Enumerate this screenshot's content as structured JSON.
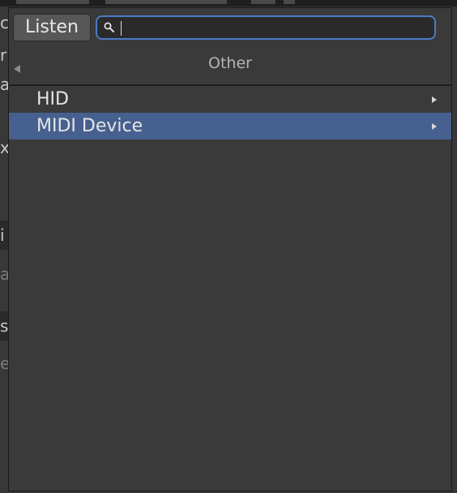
{
  "background_peek": [
    {
      "text": "c",
      "dim": false
    },
    {
      "text": "r",
      "dim": false
    },
    {
      "text": "a",
      "dim": false
    },
    {
      "text": "x",
      "dim": false
    },
    {
      "text": "i",
      "dim": false
    },
    {
      "text": "a",
      "dim": true
    },
    {
      "text": "sc",
      "dim": false
    },
    {
      "text": "e",
      "dim": true
    }
  ],
  "toolbar": {
    "listen_label": "Listen",
    "search_value": "",
    "search_icon": "magnifier-icon"
  },
  "header": {
    "title": "Other",
    "back_icon": "back-arrow-icon"
  },
  "list": {
    "items": [
      {
        "label": "HID",
        "selected": false,
        "has_submenu": true
      },
      {
        "label": "MIDI Device",
        "selected": true,
        "has_submenu": true
      }
    ]
  },
  "colors": {
    "selection": "#46608f",
    "search_focus_border": "#4c7ac4",
    "popup_bg": "#3a3a3a"
  }
}
